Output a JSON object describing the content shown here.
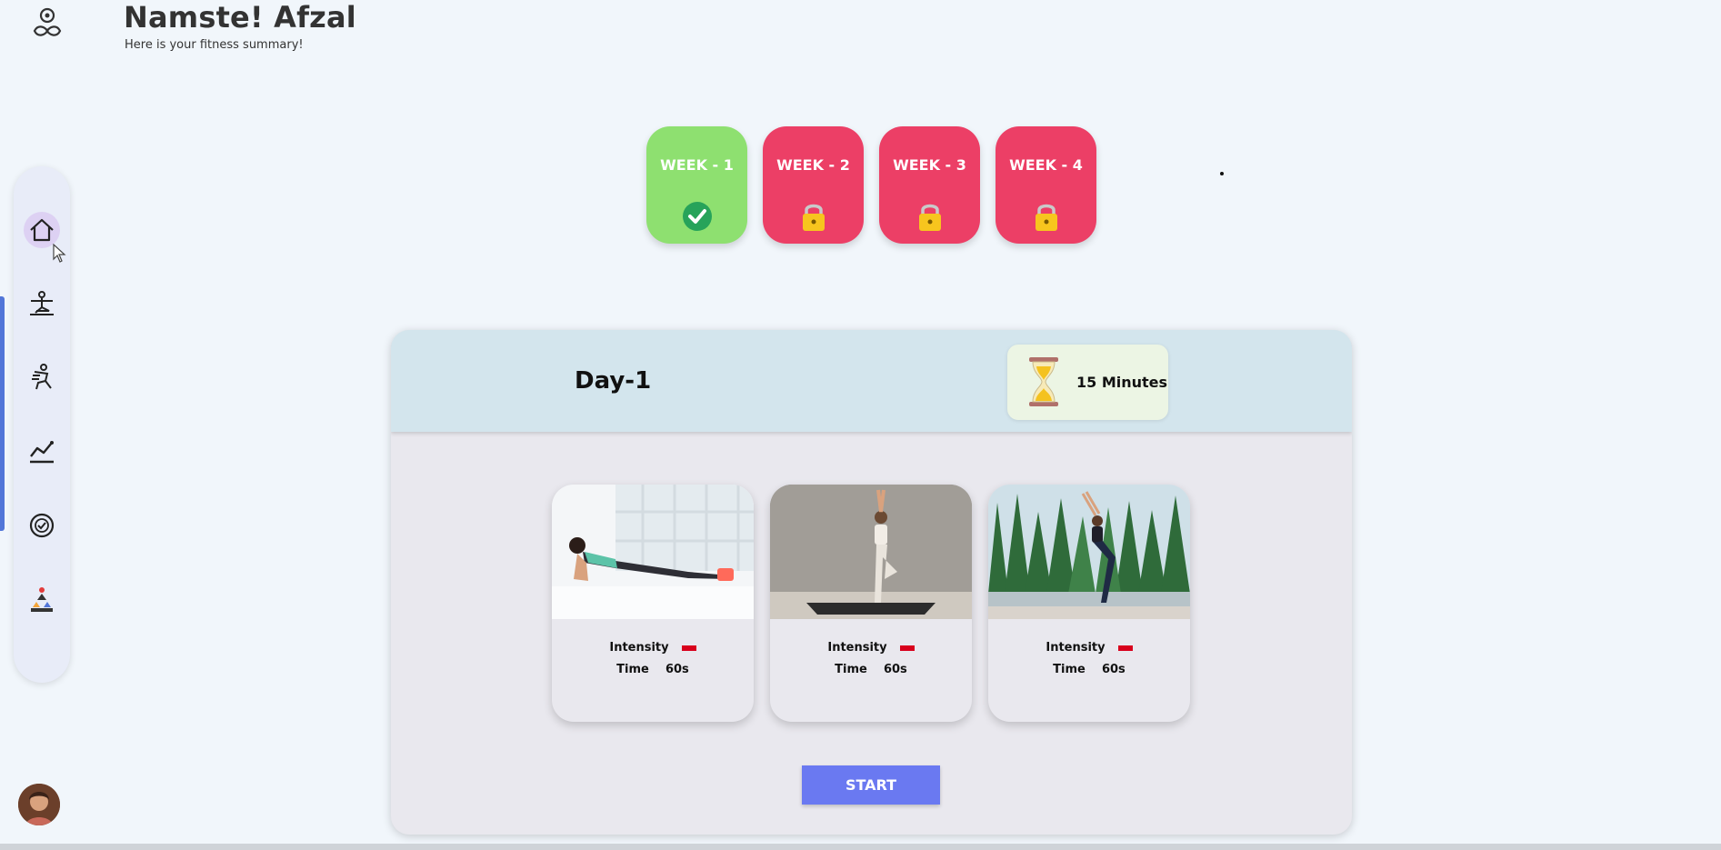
{
  "header": {
    "title": "Namste! Afzal",
    "subtitle": "Here is your fitness summary!",
    "logo_icon": "yoga-lotus-logo-icon"
  },
  "sidebar": {
    "items": [
      {
        "icon": "home-icon",
        "active": true
      },
      {
        "icon": "yoga-pose-icon",
        "active": false
      },
      {
        "icon": "exercise-icon",
        "active": false
      },
      {
        "icon": "progress-chart-icon",
        "active": false
      },
      {
        "icon": "badge-icon",
        "active": false
      },
      {
        "icon": "leaderboard-icon",
        "active": false
      }
    ],
    "avatar_icon": "user-avatar"
  },
  "weeks": [
    {
      "label": "WEEK - 1",
      "status": "completed",
      "icon": "check-icon",
      "color": "#8ee070"
    },
    {
      "label": "WEEK - 2",
      "status": "locked",
      "icon": "lock-icon",
      "color": "#ec3f66"
    },
    {
      "label": "WEEK - 3",
      "status": "locked",
      "icon": "lock-icon",
      "color": "#ec3f66"
    },
    {
      "label": "WEEK - 4",
      "status": "locked",
      "icon": "lock-icon",
      "color": "#ec3f66"
    }
  ],
  "session": {
    "day": "Day-1",
    "duration": "15 Minutes",
    "duration_icon": "hourglass-icon"
  },
  "exercises": [
    {
      "image": "plank-pose-photo",
      "intensity_label": "Intensity",
      "time_label": "Time",
      "time_value": "60s"
    },
    {
      "image": "tree-pose-photo",
      "intensity_label": "Intensity",
      "time_label": "Time",
      "time_value": "60s"
    },
    {
      "image": "chair-pose-photo",
      "intensity_label": "Intensity",
      "time_label": "Time",
      "time_value": "60s"
    }
  ],
  "start_button": "START",
  "colors": {
    "accent": "#6a79f1",
    "completed": "#8ee070",
    "locked": "#ec3f66",
    "intensity": "#d8001c",
    "panel_header": "#d3e5ed"
  }
}
